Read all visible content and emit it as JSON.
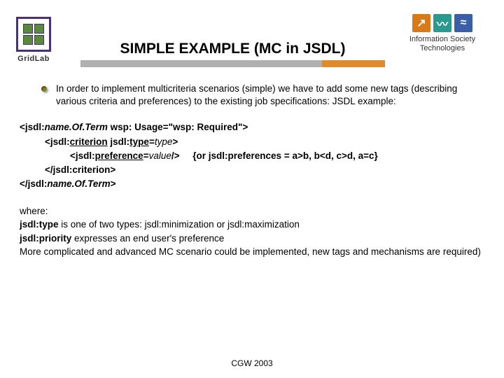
{
  "header": {
    "left_logo_label": "GridLab",
    "right_logo_line1": "Information Society",
    "right_logo_line2": "Technologies",
    "title": "SIMPLE EXAMPLE (MC in JSDL)"
  },
  "bullet": {
    "text": "In order to implement multicriteria scenarios (simple) we have to add some new tags (describing various criteria and preferences) to the existing job specifications: JSDL example:"
  },
  "code": {
    "l1a_prefix": "<jsdl:",
    "l1a_name": "name.Of.Term",
    "l1a_mid": " wsp: Usage=\"wsp: Required\">",
    "l2a_prefix": "<jsdl:",
    "l2a_crit": "criterion",
    "l2a_mid": " jsdl:",
    "l2a_type_b": "type",
    "l2a_eq": "=",
    "l2a_type_i": "type",
    "l2a_close": ">",
    "l3a_prefix": "<jsdl:",
    "l3a_pref": "preference",
    "l3a_eq": "=",
    "l3a_val": "value",
    "l3a_close": "/>",
    "l3a_alt": "{or jsdl:preferences = a>b, b<d, c>d, a=c}",
    "l2b": "</jsdl:criterion>",
    "l1b_prefix": "</jsdl:",
    "l1b_name": "name.Of.Term",
    "l1b_close": ">"
  },
  "where": {
    "w1": "where:",
    "w2a": "jsdl:type",
    "w2b": " is one of two types: jsdl:minimization or jsdl:maximization",
    "w3a": "jsdl:priority",
    "w3b": " expresses an end user's preference",
    "w4": "More complicated and advanced MC scenario could be implemented, new tags and mechanisms are required)"
  },
  "footer": {
    "text": "CGW 2003"
  }
}
